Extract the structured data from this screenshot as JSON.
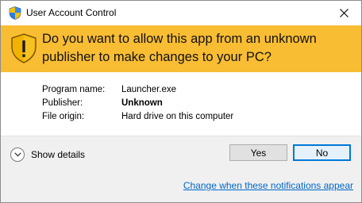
{
  "window": {
    "title": "User Account Control",
    "title_icon": "uac-shield-icon",
    "close_icon": "close-icon"
  },
  "banner": {
    "message": "Do you want to allow this app from an unknown publisher to make changes to your PC?",
    "icon": "warning-shield-icon",
    "color": "#f9bd34"
  },
  "details": [
    {
      "label": "Program name:",
      "value": "Launcher.exe"
    },
    {
      "label": "Publisher:",
      "value": "Unknown"
    },
    {
      "label": "File origin:",
      "value": "Hard drive on this computer"
    }
  ],
  "footer": {
    "show_details": "Show details",
    "expand_icon": "chevron-down-icon",
    "yes_label": "Yes",
    "no_label": "No",
    "notification_link": "Change when these notifications appear"
  },
  "colors": {
    "focus_border": "#0078d7",
    "link": "#0066cc"
  }
}
